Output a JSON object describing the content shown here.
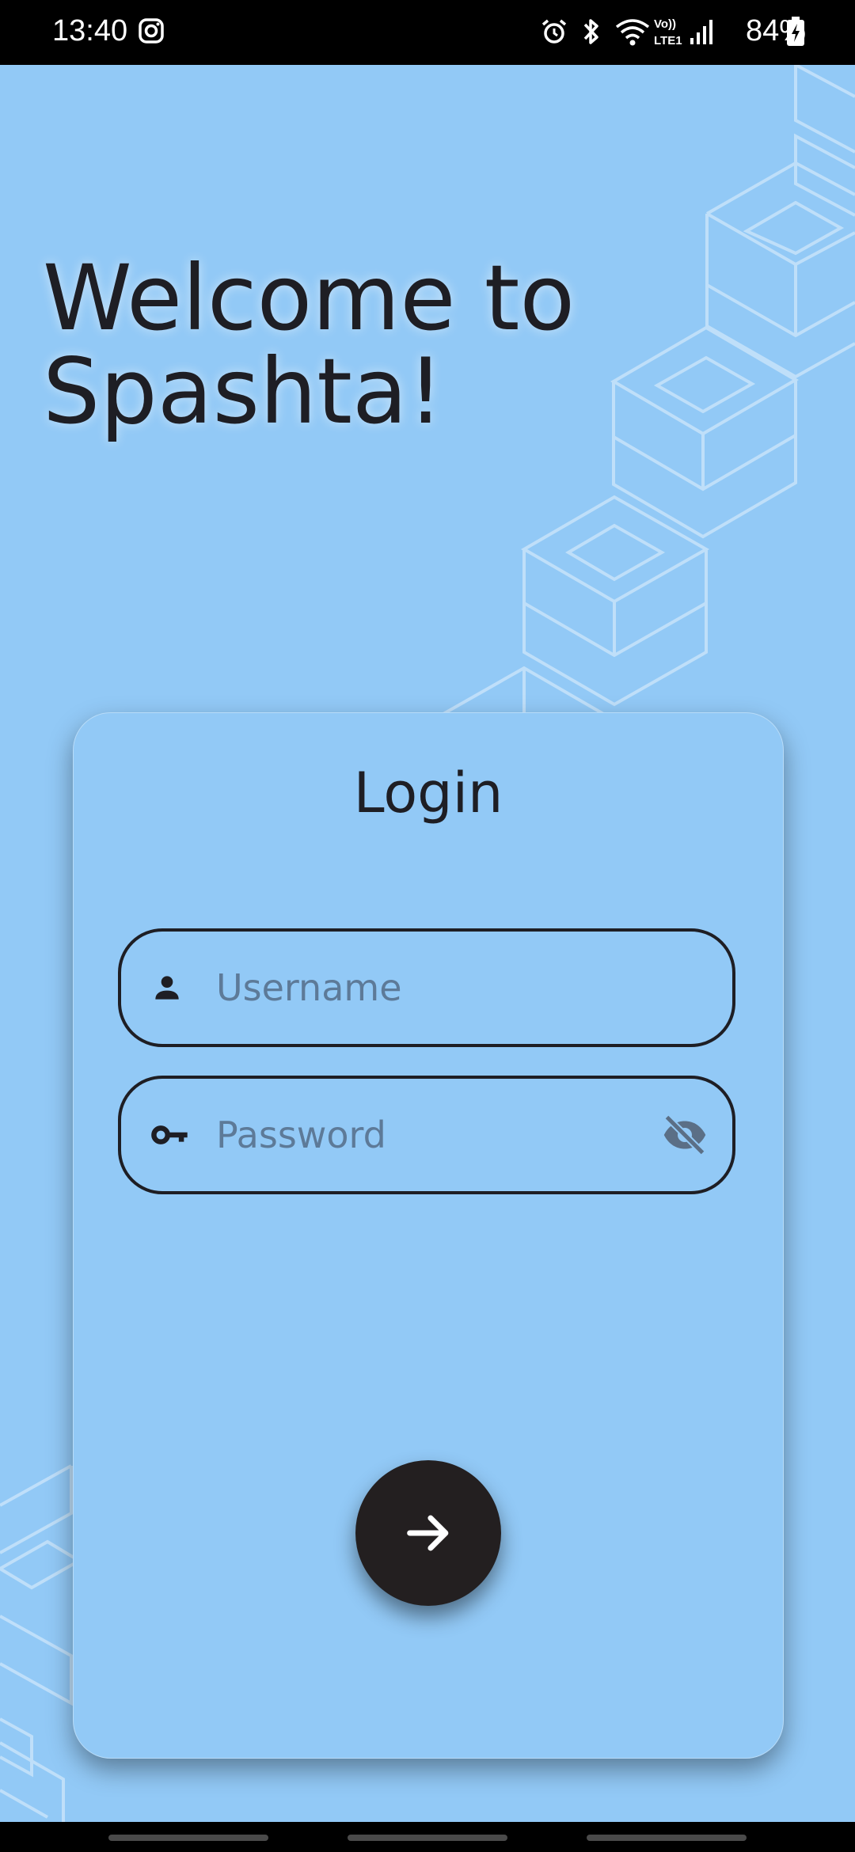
{
  "status_bar": {
    "time": "13:40",
    "battery_percent": "84%",
    "icons": [
      "instagram-icon",
      "alarm-icon",
      "bluetooth-icon",
      "wifi-icon",
      "volte-icon",
      "signal-icon",
      "battery-charging-icon"
    ]
  },
  "welcome": {
    "line1": "Welcome to",
    "line2": "Spashta!"
  },
  "login_card": {
    "title": "Login",
    "username": {
      "value": "",
      "placeholder": "Username",
      "icon": "person-icon"
    },
    "password": {
      "value": "",
      "placeholder": "Password",
      "icon": "key-icon",
      "toggle_icon": "visibility-off-icon"
    },
    "submit_icon": "arrow-forward-icon"
  },
  "colors": {
    "background": "#92c9f6",
    "text": "#1e1e24",
    "button": "#231f20",
    "placeholder": "#5d7a98"
  }
}
